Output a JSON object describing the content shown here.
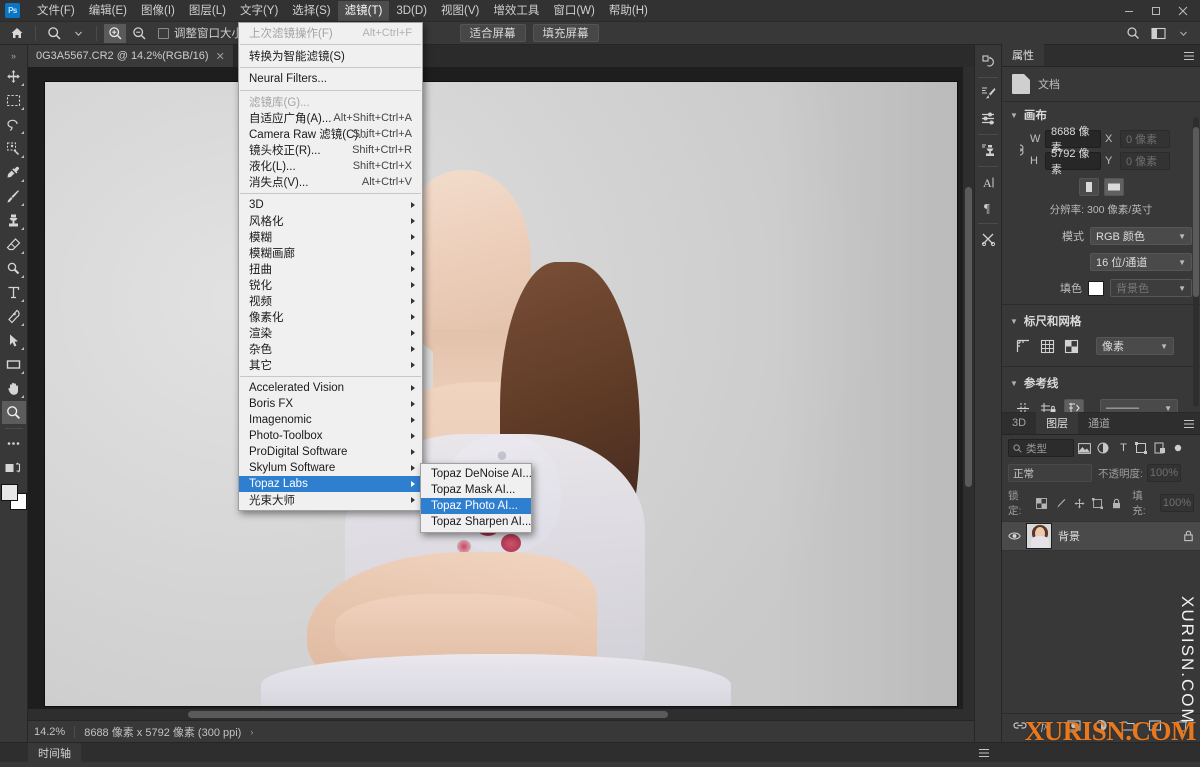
{
  "app": {
    "logo": "Ps",
    "window_controls": {
      "minimize": "—",
      "maximize": "▢",
      "close": "✕"
    }
  },
  "menubar": {
    "items": [
      {
        "label": "文件(F)",
        "name": "file"
      },
      {
        "label": "编辑(E)",
        "name": "edit"
      },
      {
        "label": "图像(I)",
        "name": "image"
      },
      {
        "label": "图层(L)",
        "name": "layer"
      },
      {
        "label": "文字(Y)",
        "name": "type"
      },
      {
        "label": "选择(S)",
        "name": "select"
      },
      {
        "label": "滤镜(T)",
        "name": "filter",
        "open": true
      },
      {
        "label": "3D(D)",
        "name": "3d"
      },
      {
        "label": "视图(V)",
        "name": "view"
      },
      {
        "label": "增效工具",
        "name": "plugins"
      },
      {
        "label": "窗口(W)",
        "name": "window"
      },
      {
        "label": "帮助(H)",
        "name": "help"
      }
    ]
  },
  "options_bar": {
    "home_icon": "home-icon",
    "tool_icon": "zoom-tool-icon",
    "preset_chevron": "chevron-down-icon",
    "zoom_in_icon": "zoom-in-icon",
    "zoom_out_icon": "zoom-out-icon",
    "checkbox_label": "调整窗口大小以满屏显示",
    "checkbox_checked": false,
    "buttons": [
      "适合屏幕",
      "填充屏幕"
    ],
    "search_icon": "search-icon",
    "workspace_icon": "workspace-icon",
    "workspace_chevron": "chevron-down-icon"
  },
  "toolbar": {
    "collapse_icon": "double-chevron-right-icon",
    "tools": [
      {
        "name": "move-tool",
        "icon": "move-icon"
      },
      {
        "name": "marquee-tool",
        "icon": "rect-marquee-icon"
      },
      {
        "name": "lasso-tool",
        "icon": "lasso-icon"
      },
      {
        "name": "quick-selection-tool",
        "icon": "quick-select-icon"
      },
      {
        "name": "eyedropper-tool",
        "icon": "eyedropper-icon"
      },
      {
        "name": "healing-brush-tool",
        "icon": "brush-icon"
      },
      {
        "name": "clone-stamp-tool",
        "icon": "stamp-icon"
      },
      {
        "name": "eraser-tool",
        "icon": "eraser-icon"
      },
      {
        "name": "dodge-tool",
        "icon": "dodge-icon"
      },
      {
        "name": "type-tool",
        "icon": "text-T-icon"
      },
      {
        "name": "pen-tool",
        "icon": "pen-icon"
      },
      {
        "name": "path-selection-tool",
        "icon": "path-arrow-icon"
      },
      {
        "name": "shape-tool",
        "icon": "rectangle-icon"
      },
      {
        "name": "hand-tool",
        "icon": "hand-icon"
      },
      {
        "name": "zoom-tool",
        "icon": "magnifier-icon",
        "active": true
      },
      {
        "name": "more-tools",
        "icon": "ellipsis-icon"
      },
      {
        "name": "edit-toolbar",
        "icon": "quick-mask-icon"
      }
    ],
    "foreground_color": "#e8e8e8",
    "background_color": "#ffffff"
  },
  "document": {
    "tab_title": "0G3A5567.CR2 @ 14.2%(RGB/16)",
    "tab_close_icon": "close-icon"
  },
  "statusbar": {
    "zoom": "14.2%",
    "dimensions": "8688 像素 x 5792 像素 (300 ppi)",
    "arrow_icon": "chevron-right-icon"
  },
  "filter_menu": {
    "groups": [
      [
        {
          "label": "上次滤镜操作(F)",
          "shortcut": "Alt+Ctrl+F",
          "disabled": true
        }
      ],
      [
        {
          "label": "转换为智能滤镜(S)",
          "shortcut": ""
        }
      ],
      [
        {
          "label": "Neural Filters...",
          "shortcut": ""
        }
      ],
      [
        {
          "label": "滤镜库(G)...",
          "shortcut": "",
          "disabled": true
        },
        {
          "label": "自适应广角(A)...",
          "shortcut": "Alt+Shift+Ctrl+A"
        },
        {
          "label": "Camera Raw 滤镜(C)...",
          "shortcut": "Shift+Ctrl+A"
        },
        {
          "label": "镜头校正(R)...",
          "shortcut": "Shift+Ctrl+R"
        },
        {
          "label": "液化(L)...",
          "shortcut": "Shift+Ctrl+X"
        },
        {
          "label": "消失点(V)...",
          "shortcut": "Alt+Ctrl+V"
        }
      ],
      [
        {
          "label": "3D",
          "submenu": true
        },
        {
          "label": "风格化",
          "submenu": true
        },
        {
          "label": "模糊",
          "submenu": true
        },
        {
          "label": "模糊画廊",
          "submenu": true
        },
        {
          "label": "扭曲",
          "submenu": true
        },
        {
          "label": "锐化",
          "submenu": true
        },
        {
          "label": "视频",
          "submenu": true
        },
        {
          "label": "像素化",
          "submenu": true
        },
        {
          "label": "渲染",
          "submenu": true
        },
        {
          "label": "杂色",
          "submenu": true
        },
        {
          "label": "其它",
          "submenu": true
        }
      ],
      [
        {
          "label": "Accelerated Vision",
          "submenu": true
        },
        {
          "label": "Boris FX",
          "submenu": true
        },
        {
          "label": "Imagenomic",
          "submenu": true
        },
        {
          "label": "Photo-Toolbox",
          "submenu": true
        },
        {
          "label": "ProDigital Software",
          "submenu": true
        },
        {
          "label": "Skylum Software",
          "submenu": true
        },
        {
          "label": "Topaz Labs",
          "submenu": true,
          "highlighted": true
        },
        {
          "label": "光束大师",
          "submenu": true
        }
      ]
    ],
    "highlight_color": "#2f7fd0"
  },
  "topaz_submenu": {
    "items": [
      {
        "label": "Topaz DeNoise AI...",
        "highlighted": false
      },
      {
        "label": "Topaz Mask AI...",
        "highlighted": false
      },
      {
        "label": "Topaz Photo AI...",
        "highlighted": true
      },
      {
        "label": "Topaz Sharpen AI...",
        "highlighted": false
      }
    ]
  },
  "rail": {
    "icons": [
      {
        "name": "history-icon",
        "glyph": "↻"
      },
      {
        "name": "brush-settings-icon",
        "glyph": "✒"
      },
      {
        "name": "adjustments-icon",
        "glyph": "⇥"
      },
      {
        "name": "clone-source-icon",
        "glyph": "⎙"
      },
      {
        "name": "character-panel-icon",
        "glyph": "A"
      },
      {
        "name": "paragraph-panel-icon",
        "glyph": "¶"
      },
      {
        "name": "tool-presets-icon",
        "glyph": "✂"
      }
    ]
  },
  "properties_panel": {
    "tab_label": "属性",
    "menu_icon": "panel-menu-icon",
    "doc_label": "文档",
    "doc_icon": "document-icon",
    "canvas_section": "画布",
    "link_icon": "link-icon",
    "w_label": "W",
    "w_value": "8688 像素",
    "h_label": "H",
    "h_value": "5792 像素",
    "x_label": "X",
    "x_value": "0 像素",
    "y_label": "Y",
    "y_value": "0 像素",
    "orient_portrait_icon": "portrait-orientation-icon",
    "orient_landscape_icon": "landscape-orientation-icon",
    "resolution": "分辨率: 300 像素/英寸",
    "mode_label": "模式",
    "mode_value": "RGB 颜色",
    "depth_value": "16 位/通道",
    "fill_label": "填色",
    "fill_value": "背景色",
    "rulers_section": "标尺和网格",
    "ruler_icon": "ruler-icon",
    "grid_icon": "grid-icon",
    "pattern_icon": "transparency-grid-icon",
    "units_value": "像素",
    "guides_section": "参考线",
    "guide_show_icon": "show-guides-icon",
    "guide_lock_icon": "lock-guides-icon",
    "guide_clear_icon": "clear-guides-icon",
    "guide_style_value": "———"
  },
  "layers_panel": {
    "tabs": [
      {
        "label": "3D",
        "active": false
      },
      {
        "label": "图层",
        "active": true
      },
      {
        "label": "通道",
        "active": false
      }
    ],
    "menu_icon": "panel-menu-icon",
    "filter_placeholder": "类型",
    "filter_search_icon": "search-icon",
    "filter_icons": [
      {
        "name": "filter-pixel-icon",
        "glyph": "▣"
      },
      {
        "name": "filter-adjustment-icon",
        "glyph": "◑"
      },
      {
        "name": "filter-type-icon",
        "glyph": "T"
      },
      {
        "name": "filter-shape-icon",
        "glyph": "⬚"
      },
      {
        "name": "filter-smart-icon",
        "glyph": "▤"
      },
      {
        "name": "filter-toggle-icon",
        "glyph": "●"
      }
    ],
    "blend_mode": "正常",
    "opacity_label": "不透明度:",
    "opacity_value": "100%",
    "lock_label": "锁定:",
    "lock_icons": [
      {
        "name": "lock-transparent-icon",
        "glyph": "▩"
      },
      {
        "name": "lock-image-icon",
        "glyph": "✎"
      },
      {
        "name": "lock-position-icon",
        "glyph": "✛"
      },
      {
        "name": "lock-artboard-icon",
        "glyph": "⬚"
      },
      {
        "name": "lock-all-icon",
        "glyph": "🔒"
      }
    ],
    "fill_label": "填充:",
    "fill_value": "100%",
    "layers": [
      {
        "name": "背景",
        "visible": true,
        "locked": true,
        "eye_icon": "eye-icon",
        "lock_icon": "lock-icon"
      }
    ],
    "bottom_icons": [
      {
        "name": "link-layers-icon",
        "glyph": "🔗"
      },
      {
        "name": "layer-style-icon",
        "glyph": "fx"
      },
      {
        "name": "layer-mask-icon",
        "glyph": "◪"
      },
      {
        "name": "adjustment-layer-icon",
        "glyph": "◐"
      },
      {
        "name": "new-group-icon",
        "glyph": "▭"
      },
      {
        "name": "new-layer-icon",
        "glyph": "⊞"
      },
      {
        "name": "delete-layer-icon",
        "glyph": "🗑"
      }
    ]
  },
  "timeline": {
    "tab_label": "时间轴",
    "menu_icon": "panel-menu-icon"
  },
  "watermarks": {
    "vertical": "XURISN.COM",
    "orange": "XURISN.COM",
    "orange_color": "#e8781e"
  }
}
